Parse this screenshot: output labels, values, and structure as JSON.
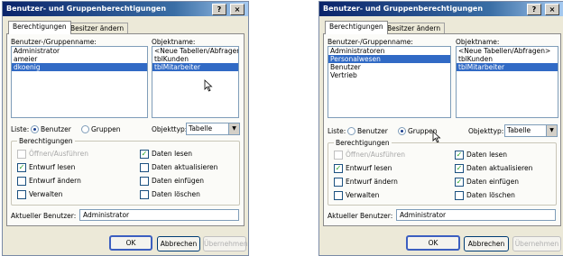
{
  "colors": {
    "title_start": "#0a246a",
    "title_end": "#a6caf0",
    "selection": "#316ac5",
    "dialog_bg": "#ece9d8"
  },
  "dialogs": [
    {
      "title": "Benutzer- und Gruppenberechtigungen",
      "title_buttons": [
        "help-icon",
        "close-icon"
      ],
      "tabs": [
        "Berechtigungen",
        "Besitzer ändern"
      ],
      "users_label": "Benutzer-/Gruppenname:",
      "users": [
        "Administrator",
        "ameier",
        "dkoenig"
      ],
      "users_selected": 2,
      "objects_label": "Objektname:",
      "objects": [
        "<Neue Tabellen/Abfragen>",
        "tblKunden",
        "tblMitarbeiter"
      ],
      "objects_selected": 2,
      "list_label": "Liste:",
      "radio_users": "Benutzer",
      "radio_groups": "Gruppen",
      "radio_selected": "users",
      "objecttype_label": "Objekttyp:",
      "objecttype_value": "Tabelle",
      "permissions_label": "Berechtigungen",
      "permissions": [
        {
          "label": "Öffnen/Ausführen",
          "checked": false,
          "disabled": true
        },
        {
          "label": "Daten lesen",
          "checked": true,
          "disabled": false
        },
        {
          "label": "Entwurf lesen",
          "checked": true,
          "disabled": false
        },
        {
          "label": "Daten aktualisieren",
          "checked": false,
          "disabled": false
        },
        {
          "label": "Entwurf ändern",
          "checked": false,
          "disabled": false
        },
        {
          "label": "Daten einfügen",
          "checked": false,
          "disabled": false
        },
        {
          "label": "Verwalten",
          "checked": false,
          "disabled": false
        },
        {
          "label": "Daten löschen",
          "checked": false,
          "disabled": false
        }
      ],
      "current_user_label": "Aktueller Benutzer:",
      "current_user": "Administrator",
      "ok": "OK",
      "cancel": "Abbrechen",
      "apply": "Übernehmen"
    },
    {
      "title": "Benutzer- und Gruppenberechtigungen",
      "title_buttons": [
        "help-icon",
        "close-icon"
      ],
      "tabs": [
        "Berechtigungen",
        "Besitzer ändern"
      ],
      "users_label": "Benutzer-/Gruppenname:",
      "users": [
        "Administratoren",
        "Personalwesen",
        "Benutzer",
        "Vertrieb"
      ],
      "users_selected": 1,
      "objects_label": "Objektname:",
      "objects": [
        "<Neue Tabellen/Abfragen>",
        "tblKunden",
        "tblMitarbeiter"
      ],
      "objects_selected": 2,
      "list_label": "Liste:",
      "radio_users": "Benutzer",
      "radio_groups": "Gruppen",
      "radio_selected": "groups",
      "objecttype_label": "Objekttyp:",
      "objecttype_value": "Tabelle",
      "permissions_label": "Berechtigungen",
      "permissions": [
        {
          "label": "Öffnen/Ausführen",
          "checked": false,
          "disabled": true
        },
        {
          "label": "Daten lesen",
          "checked": true,
          "disabled": false
        },
        {
          "label": "Entwurf lesen",
          "checked": true,
          "disabled": false
        },
        {
          "label": "Daten aktualisieren",
          "checked": true,
          "disabled": false
        },
        {
          "label": "Entwurf ändern",
          "checked": false,
          "disabled": false
        },
        {
          "label": "Daten einfügen",
          "checked": true,
          "disabled": false
        },
        {
          "label": "Verwalten",
          "checked": false,
          "disabled": false
        },
        {
          "label": "Daten löschen",
          "checked": false,
          "disabled": false
        }
      ],
      "current_user_label": "Aktueller Benutzer:",
      "current_user": "Administrator",
      "ok": "OK",
      "cancel": "Abbrechen",
      "apply": "Übernehmen"
    }
  ]
}
